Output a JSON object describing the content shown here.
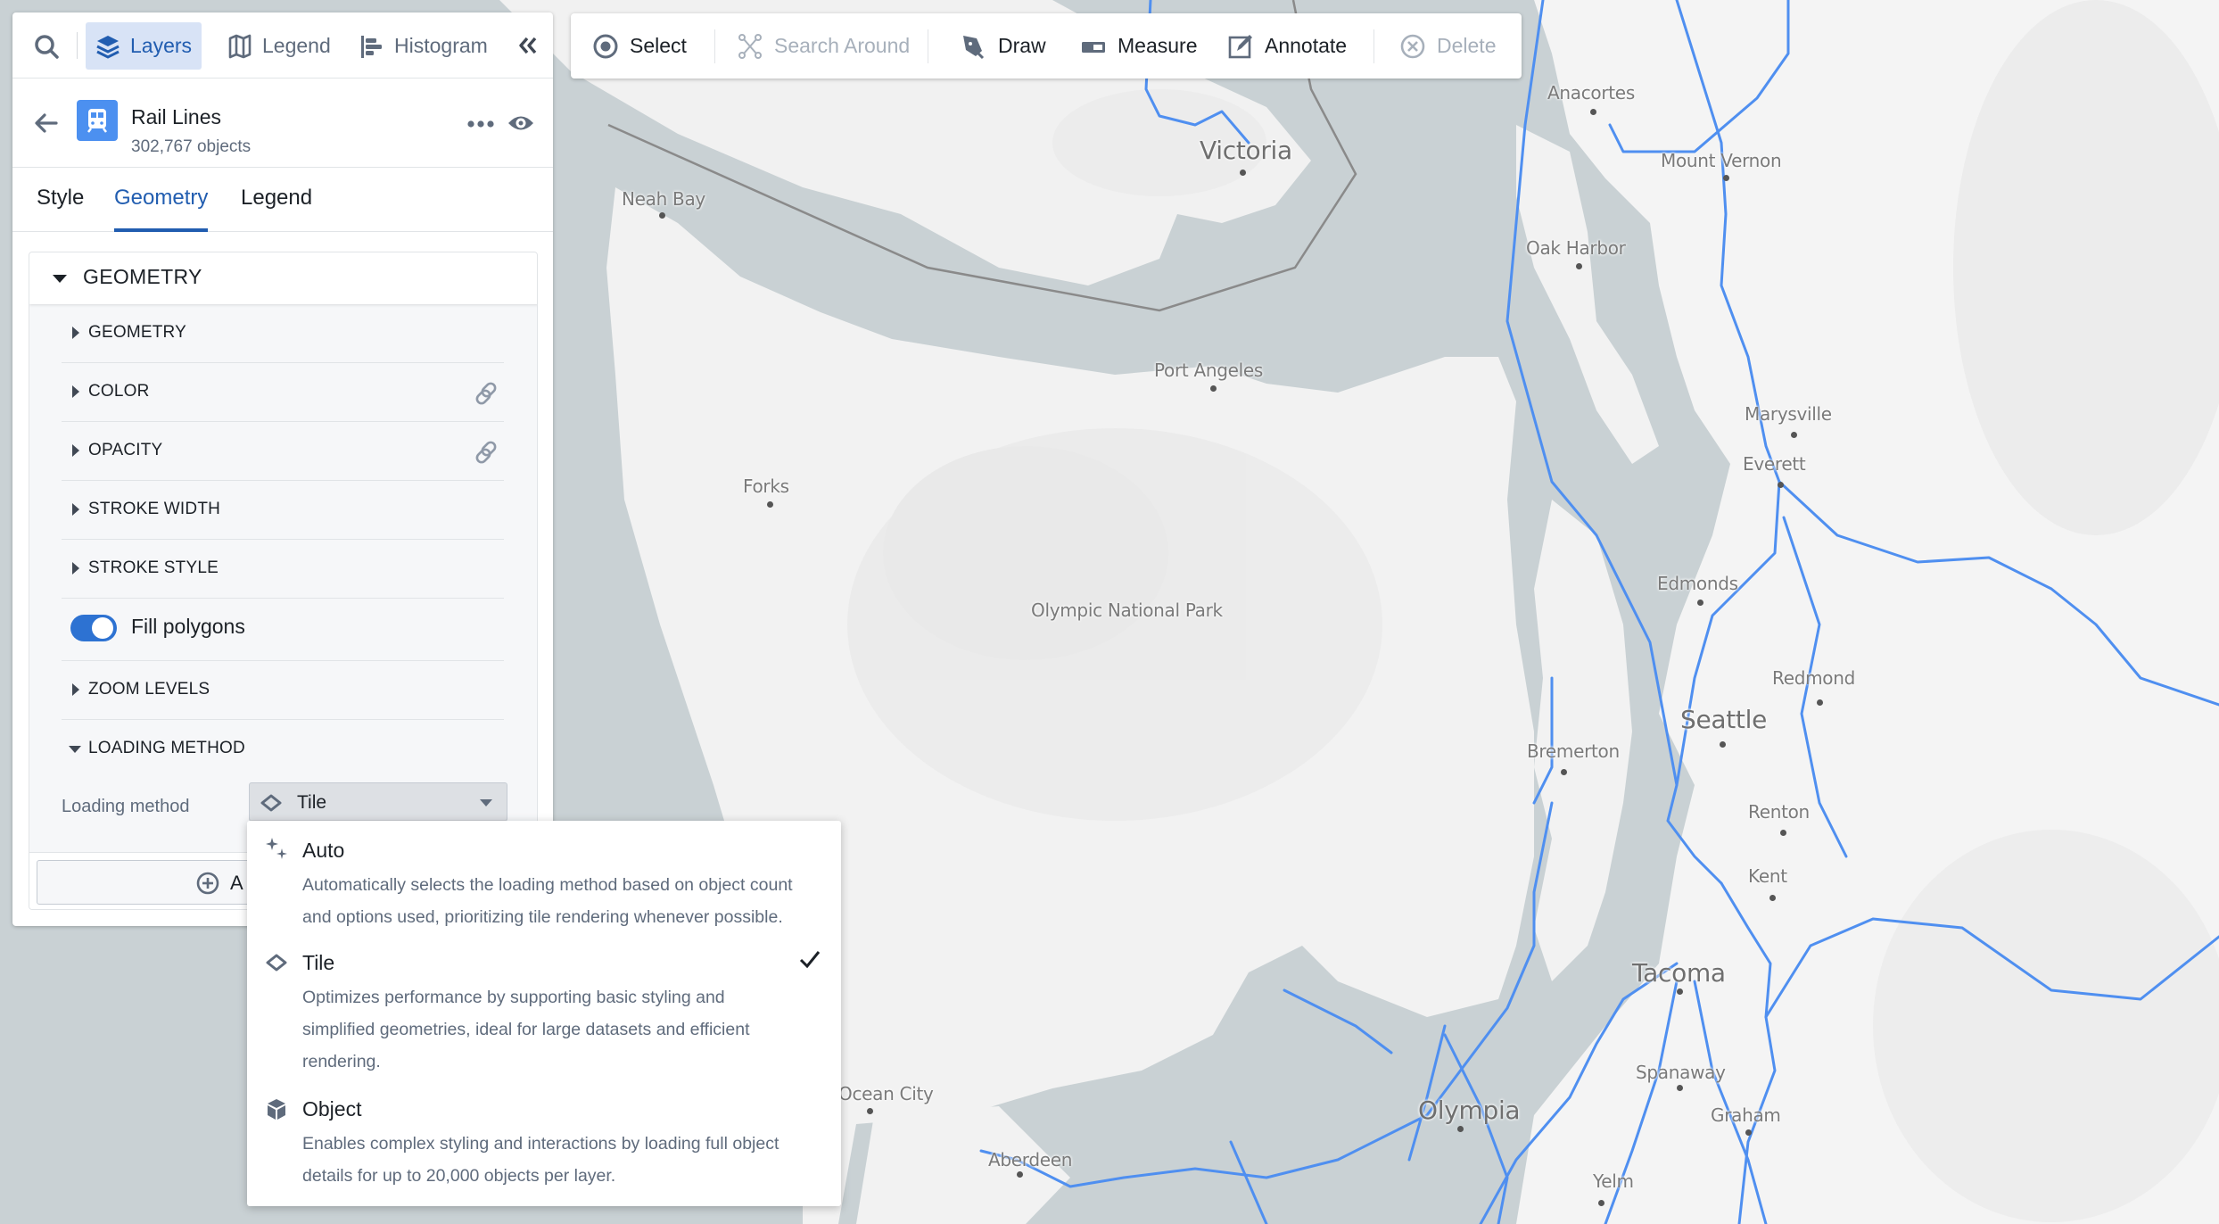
{
  "colors": {
    "accent": "#215db0",
    "layer_icon_bg": "#4c90f0",
    "toggle_on": "#2d72d2",
    "rail_line": "#4f8ff0",
    "water": "#c9d1d4",
    "land": "#f4f4f4",
    "border_line": "#8a8a8a"
  },
  "panel": {
    "nav": {
      "search_icon": "search-icon",
      "items": [
        {
          "label": "Layers",
          "icon": "layers-icon",
          "active": true
        },
        {
          "label": "Legend",
          "icon": "map-icon",
          "active": false
        },
        {
          "label": "Histogram",
          "icon": "histogram-icon",
          "active": false
        }
      ],
      "collapse_icon": "double-chevron-left-icon"
    },
    "layer": {
      "title": "Rail Lines",
      "count": "302,767 objects",
      "icon": "train-icon"
    },
    "tabs": [
      {
        "label": "Style",
        "active": false
      },
      {
        "label": "Geometry",
        "active": true
      },
      {
        "label": "Legend",
        "active": false
      }
    ],
    "section": {
      "title": "GEOMETRY",
      "rows": [
        {
          "label": "GEOMETRY",
          "linked": false
        },
        {
          "label": "COLOR",
          "linked": true
        },
        {
          "label": "OPACITY",
          "linked": true
        },
        {
          "label": "STROKE WIDTH",
          "linked": false
        },
        {
          "label": "STROKE STYLE",
          "linked": false
        }
      ],
      "fill_polygons": {
        "label": "Fill polygons",
        "enabled": true
      },
      "zoom_levels": "ZOOM LEVELS",
      "loading_method_section": "LOADING METHOD",
      "loading_method_field": {
        "label": "Loading method",
        "value": "Tile"
      },
      "add_button_visible_label": "A"
    }
  },
  "toolbar": {
    "items": [
      {
        "label": "Select",
        "icon": "select-target-icon",
        "disabled": false
      },
      {
        "label": "Search Around",
        "icon": "graph-nodes-icon",
        "disabled": true
      },
      {
        "label": "Draw",
        "icon": "pen-icon",
        "disabled": false
      },
      {
        "label": "Measure",
        "icon": "ruler-icon",
        "disabled": false
      },
      {
        "label": "Annotate",
        "icon": "annotate-icon",
        "disabled": false
      },
      {
        "label": "Delete",
        "icon": "delete-circle-icon",
        "disabled": true
      }
    ]
  },
  "loading_menu": {
    "options": [
      {
        "title": "Auto",
        "icon": "sparkle-icon",
        "selected": false,
        "desc": [
          "Automatically selects the loading method based on object count",
          "and options used, prioritizing tile rendering whenever possible."
        ]
      },
      {
        "title": "Tile",
        "icon": "diamond-icon",
        "selected": true,
        "desc": [
          "Optimizes performance by supporting basic styling and",
          "simplified geometries, ideal for large datasets and efficient",
          "rendering."
        ]
      },
      {
        "title": "Object",
        "icon": "cube-icon",
        "selected": false,
        "desc": [
          "Enables complex styling and interactions by loading full object",
          "details for up to 20,000 objects per layer."
        ]
      }
    ]
  },
  "map": {
    "labels": [
      {
        "name": "Victoria",
        "big": true
      },
      {
        "name": "Anacortes"
      },
      {
        "name": "Mount Vernon"
      },
      {
        "name": "Neah Bay"
      },
      {
        "name": "Oak Harbor"
      },
      {
        "name": "Port Angeles"
      },
      {
        "name": "Marysville"
      },
      {
        "name": "Everett"
      },
      {
        "name": "Forks"
      },
      {
        "name": "Edmonds"
      },
      {
        "name": "Olympic National Park"
      },
      {
        "name": "Redmond"
      },
      {
        "name": "Seattle",
        "big": true
      },
      {
        "name": "Bremerton"
      },
      {
        "name": "Renton"
      },
      {
        "name": "Kent"
      },
      {
        "name": "Tacoma",
        "big": true
      },
      {
        "name": "Spanaway"
      },
      {
        "name": "Ocean City"
      },
      {
        "name": "Olympia",
        "big": true
      },
      {
        "name": "Graham"
      },
      {
        "name": "Aberdeen"
      },
      {
        "name": "Yelm"
      }
    ]
  }
}
